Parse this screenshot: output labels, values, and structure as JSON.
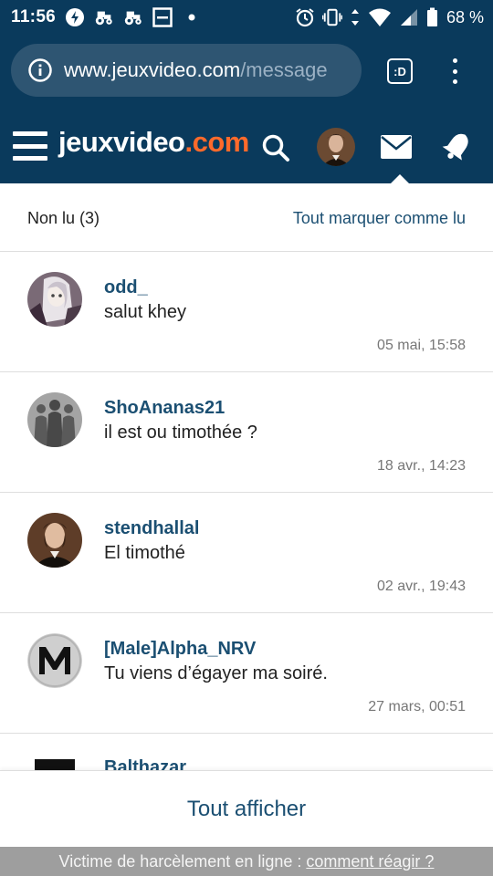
{
  "status_bar": {
    "time": "11:56",
    "battery_percent": "68 %",
    "left_icons": [
      "bolt-icon",
      "tractor-icon",
      "tractor-icon",
      "screen-icon",
      "dot-icon"
    ],
    "right_icons": [
      "alarm-icon",
      "vibrate-icon",
      "data-arrows-icon",
      "wifi-icon",
      "signal-icon",
      "battery-icon"
    ]
  },
  "browser": {
    "url_host": "www.jeuxvideo.com",
    "url_path": "/message",
    "tab_label": ":D"
  },
  "header": {
    "logo_main": "jeuxvideo",
    "logo_accent": ".com",
    "colors": {
      "bar": "#0a3a5c",
      "logo_accent": "#ff6a2b",
      "link": "#1b4f72"
    }
  },
  "messages": {
    "unread_label": "Non lu (3)",
    "mark_all_label": "Tout marquer comme lu",
    "items": [
      {
        "user": "odd_",
        "text": "salut khey",
        "date": "05 mai, 15:58"
      },
      {
        "user": "ShoAnanas21",
        "text": "il est ou timothée ?",
        "date": "18 avr., 14:23"
      },
      {
        "user": "stendhallal",
        "text": "El timothé",
        "date": "02 avr., 19:43"
      },
      {
        "user": "[Male]Alpha_NRV",
        "text": "Tu viens d’égayer ma soiré.",
        "date": "27 mars, 00:51"
      }
    ],
    "partial_user": "Balthazar",
    "show_all_label": "Tout afficher"
  },
  "footer": {
    "text": "Victime de harcèlement en ligne :",
    "link": "comment réagir ?"
  }
}
